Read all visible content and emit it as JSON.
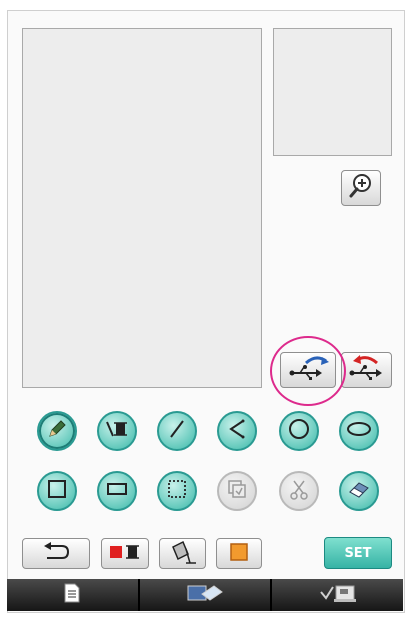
{
  "screen": {
    "canvas": "drawing-canvas",
    "preview": "preview-window"
  },
  "buttons": {
    "zoom": "zoom-in-icon",
    "usb_save": "usb-save-icon",
    "usb_load": "usb-load-icon",
    "set_label": "SET"
  },
  "tools_row1": [
    "pencil",
    "line-type",
    "straight-line",
    "polyline",
    "circle",
    "ellipse"
  ],
  "tools_row2": [
    "square",
    "rectangle",
    "selection",
    "stamp",
    "cut",
    "eraser"
  ],
  "bottom_row": [
    "undo",
    "line-color",
    "fill-bucket",
    "fill-color"
  ],
  "nav": [
    "page-view",
    "image-to-stitch",
    "embroidery-machine"
  ],
  "colors": {
    "accent": "#56c4b6",
    "highlight": "#dd2a8c",
    "line_color_red": "#e02020",
    "fill_color_orange": "#f29a2e"
  }
}
